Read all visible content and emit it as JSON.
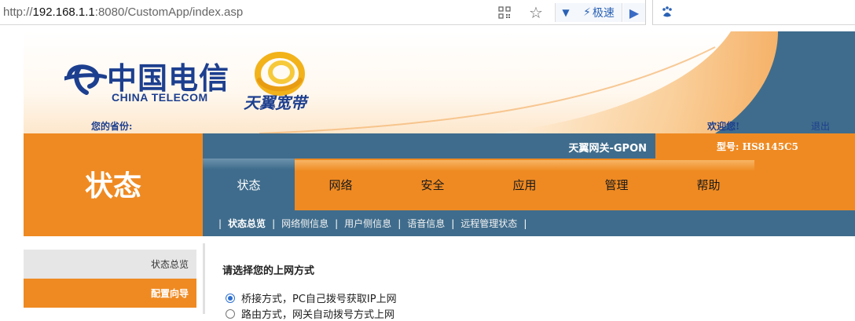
{
  "browser": {
    "url_prefix": "http://",
    "url_host": "192.168.1.1",
    "url_rest": ":8080/CustomApp/index.asp",
    "speed_label": "极速",
    "icons": [
      "qr-code-icon",
      "star-icon",
      "dropdown-icon",
      "bolt-icon",
      "play-icon",
      "baidu-paw-icon"
    ]
  },
  "header": {
    "brand_zh": "中国电信",
    "brand_en": "CHINA TELECOM",
    "tianyi": "天翼宽带",
    "province_label": "您的省份:",
    "welcome": "欢迎您!",
    "logout": "退出"
  },
  "side_title": "状态",
  "info_bar": {
    "gateway": "天翼网关-GPON",
    "model": "型号: HS8145C5"
  },
  "nav": {
    "items": [
      "状态",
      "网络",
      "安全",
      "应用",
      "管理",
      "帮助"
    ],
    "active": "状态"
  },
  "sub_nav": {
    "items": [
      "状态总览",
      "网络侧信息",
      "用户侧信息",
      "语音信息",
      "远程管理状态"
    ],
    "active": "状态总览"
  },
  "sidebar": {
    "items": [
      "状态总览",
      "配置向导"
    ]
  },
  "content": {
    "title": "请选择您的上网方式",
    "options": [
      "桥接方式，PC自己拨号获取IP上网",
      "路由方式，网关自动拨号方式上网"
    ],
    "selected_index": 0
  },
  "colors": {
    "orange": "#ef8a22",
    "blue": "#3f6c8c",
    "brand_blue": "#1d3f8f"
  }
}
